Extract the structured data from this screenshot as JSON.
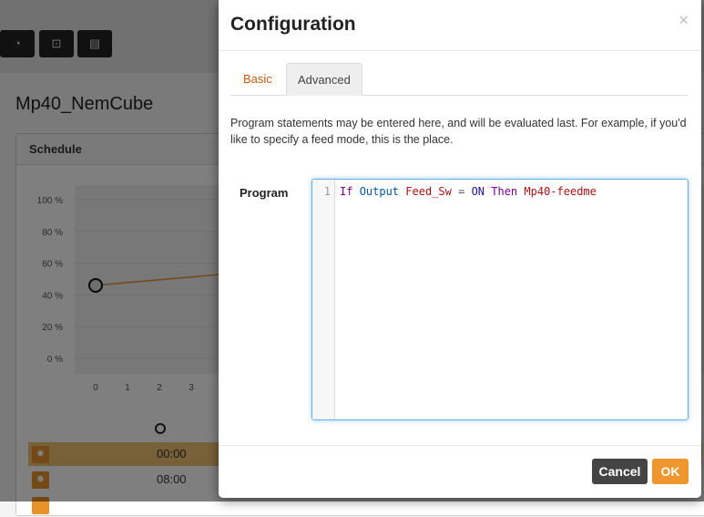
{
  "background": {
    "toolbar": [
      {
        "icon": "dashboard-icon"
      },
      {
        "icon": "outlet-icon"
      },
      {
        "icon": "keyboard-icon"
      }
    ],
    "page_title": "Mp40_NemCube",
    "panel_title": "Schedule",
    "chart_data": {
      "type": "line",
      "y_ticks": [
        "100 %",
        "80 %",
        "60 %",
        "40 %",
        "20 %",
        "0 %"
      ],
      "x_ticks": [
        "0",
        "1",
        "2",
        "3"
      ],
      "ylim": [
        0,
        100
      ],
      "series": [
        {
          "x": [
            0,
            8
          ],
          "y": [
            46,
            60
          ]
        }
      ],
      "color": "#e8922a",
      "grid": true
    },
    "schedule_header_icon": "clock-icon",
    "rows": [
      {
        "time": "00:00",
        "highlighted": true
      },
      {
        "time": "08:00",
        "highlighted": false
      }
    ]
  },
  "modal": {
    "title": "Configuration",
    "close": "×",
    "tabs": [
      {
        "label": "Basic",
        "active": false
      },
      {
        "label": "Advanced",
        "active": true
      }
    ],
    "description": "Program statements may be entered here, and will be evaluated last. For example, if you'd like to specify a feed mode, this is the place.",
    "program_label": "Program",
    "editor": {
      "line_number": "1",
      "tokens": [
        "If",
        "Output",
        "Feed_Sw",
        "=",
        "ON",
        "Then",
        "Mp40-feedme"
      ]
    },
    "cancel": "Cancel",
    "ok": "OK",
    "accent": "#f0962e"
  }
}
